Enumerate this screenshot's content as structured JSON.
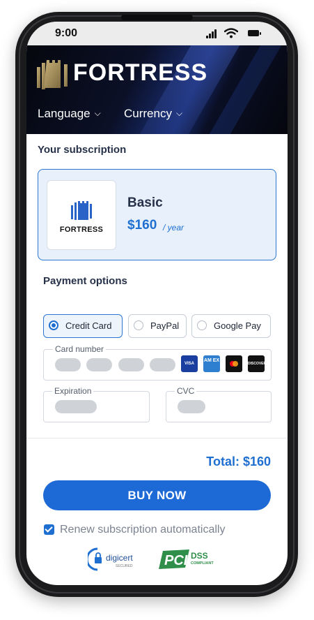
{
  "status_bar": {
    "time": "9:00"
  },
  "header": {
    "brand": "FORTRESS",
    "nav": [
      {
        "label": "Language"
      },
      {
        "label": "Currency"
      }
    ]
  },
  "subscription": {
    "title": "Your subscription",
    "plan_logo_text": "FORTRESS",
    "plan_name": "Basic",
    "price": "$160",
    "period": "/ year"
  },
  "payment": {
    "title": "Payment options",
    "options": [
      {
        "label": "Credit Card",
        "selected": true
      },
      {
        "label": "PayPal",
        "selected": false
      },
      {
        "label": "Google Pay",
        "selected": false
      }
    ],
    "card_number_label": "Card number",
    "expiration_label": "Expiration",
    "cvc_label": "CVC",
    "card_brands": [
      "visa",
      "amex",
      "mastercard",
      "discover"
    ],
    "card_brand_text": {
      "visa": "VISA",
      "amex": "AM EX",
      "discover": "DISCOVER"
    }
  },
  "checkout": {
    "total": "Total: $160",
    "buy_label": "BUY NOW",
    "renew_label": "Renew subscription automatically",
    "renew_checked": true
  },
  "badges": {
    "digicert": "digicert",
    "digicert_sub": "SECURED",
    "pci": "PCI",
    "pci_dss": "DSS",
    "pci_sub": "COMPLIANT"
  },
  "colors": {
    "accent": "#1f6fd1",
    "button": "#1d6ad6",
    "plan_bg": "#e7f0fb",
    "header_dark": "#05070e"
  }
}
